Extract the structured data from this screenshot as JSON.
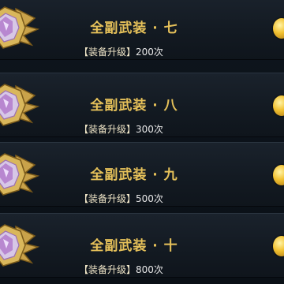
{
  "rows": [
    {
      "title": "全副武装 · 七",
      "tag": "【装备升级】",
      "count": "200次"
    },
    {
      "title": "全副武装 · 八",
      "tag": "【装备升级】",
      "count": "300次"
    },
    {
      "title": "全副武装 · 九",
      "tag": "【装备升级】",
      "count": "500次"
    },
    {
      "title": "全副武装 · 十",
      "tag": "【装备升级】",
      "count": "800次"
    }
  ],
  "icons": {
    "badge": "winged-gem-badge-icon",
    "reward": "gold-coin-icon"
  },
  "colors": {
    "title": "#e7c25a",
    "row_bg": "#151c24",
    "page_bg": "#0b1118"
  }
}
